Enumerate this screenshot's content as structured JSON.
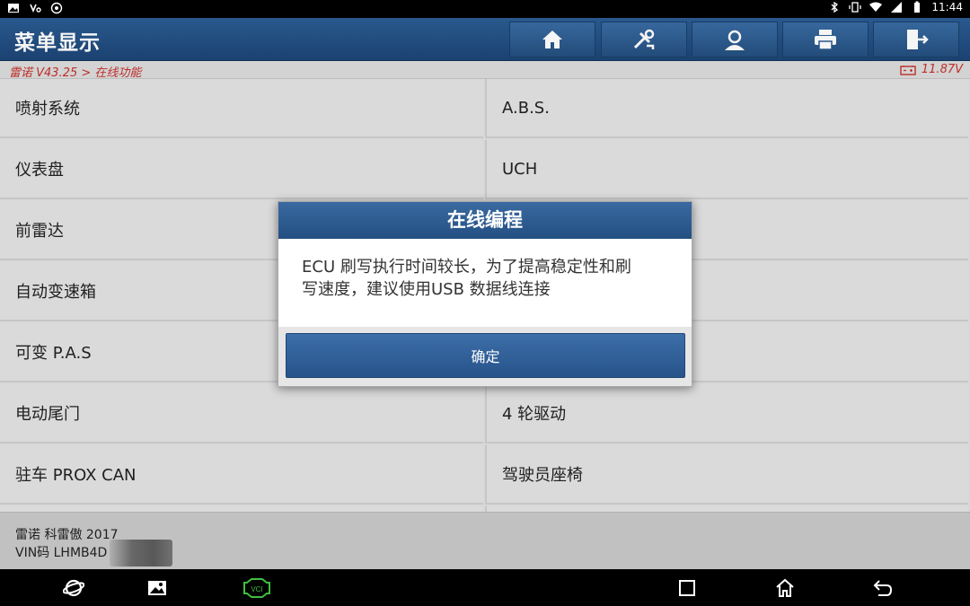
{
  "status_bar": {
    "left_icons": [
      "image-icon",
      "voicemail-icon",
      "settings-icon"
    ],
    "right_icons": [
      "bluetooth-icon",
      "vibrate-icon",
      "wifi-icon",
      "signal-icon",
      "battery-icon"
    ],
    "time": "11:44"
  },
  "header": {
    "title": "菜单显示",
    "toolbar": [
      "home-icon",
      "diagnose-icon",
      "user-icon",
      "print-icon",
      "exit-icon"
    ]
  },
  "breadcrumb": {
    "path": "雷诺 V43.25 > 在线功能",
    "voltage": "11.87V"
  },
  "menu": {
    "rows": [
      {
        "left": "喷射系统",
        "right": "A.B.S."
      },
      {
        "left": "仪表盘",
        "right": "UCH"
      },
      {
        "left": "前雷达",
        "right": ""
      },
      {
        "left": "自动变速箱",
        "right": ""
      },
      {
        "left": "可变 P.A.S",
        "right": ""
      },
      {
        "left": "电动尾门",
        "right": "4 轮驱动"
      },
      {
        "left": "驻车 PROX CAN",
        "right": "驾驶员座椅"
      }
    ]
  },
  "footer": {
    "vehicle": "雷诺 科雷傲 2017",
    "vin": "VIN码 LHMB4D"
  },
  "dialog": {
    "title": "在线编程",
    "message_line1": "ECU 刷写执行时间较长，为了提高稳定性和刷",
    "message_line2": "写速度，建议使用USB 数据线连接",
    "ok_label": "确定"
  },
  "nav_bar": {
    "icons": [
      "browser-icon",
      "gallery-icon",
      "vci-icon",
      "recent-apps-icon",
      "home-nav-icon",
      "back-icon"
    ],
    "vci_label": "VCI"
  },
  "colors": {
    "header_blue": "#24507f",
    "breadcrumb_red": "#c4302b",
    "vci_green": "#3fbf3f"
  }
}
